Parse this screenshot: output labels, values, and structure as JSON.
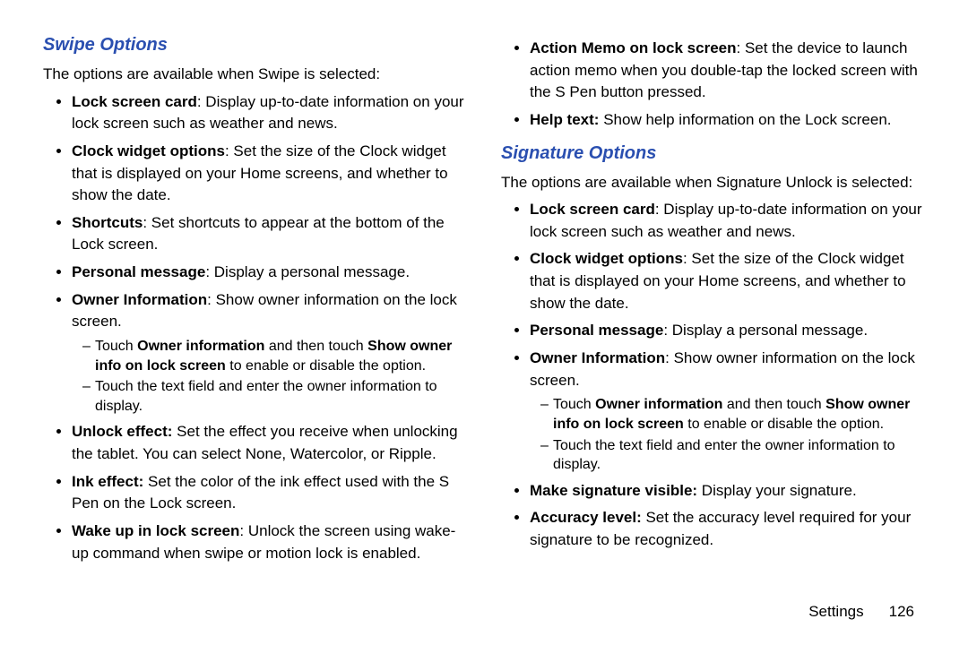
{
  "left": {
    "heading": "Swipe Options",
    "intro": "The options are available when Swipe is selected:",
    "b0": {
      "bold": "Lock screen card",
      "rest": ": Display up-to-date information on your lock screen such as weather and news."
    },
    "b1": {
      "bold": "Clock widget options",
      "rest": ": Set the size of the Clock widget that is displayed on your Home screens, and whether to show the date."
    },
    "b2": {
      "bold": "Shortcuts",
      "rest": ": Set shortcuts to appear at the bottom of the Lock screen."
    },
    "b3": {
      "bold": "Personal message",
      "rest": ": Display a personal message."
    },
    "b4": {
      "bold": "Owner Information",
      "rest": ": Show owner information on the lock screen.",
      "s0": {
        "p0": "Touch ",
        "b0": "Owner information",
        "p1": " and then touch ",
        "b1": "Show owner info on lock screen",
        "p2": " to enable or disable the option."
      },
      "s1": {
        "p0": "Touch the text field and enter the owner information to display."
      }
    },
    "b5": {
      "bold": "Unlock effect:",
      "rest": " Set the effect you receive when unlocking the tablet. You can select None, Watercolor, or Ripple."
    },
    "b6": {
      "bold": "Ink effect:",
      "rest": " Set the color of the ink effect used with the S Pen on the Lock screen."
    },
    "b7": {
      "bold": "Wake up in lock screen",
      "rest": ": Unlock the screen using wake-up command when swipe or motion lock is enabled."
    }
  },
  "right": {
    "t0": {
      "bold": "Action Memo on lock screen",
      "rest": ": Set the device to launch action memo when you double-tap the locked screen with the S Pen button pressed."
    },
    "t1": {
      "bold": "Help text:",
      "rest": " Show help information on the Lock screen."
    },
    "heading": "Signature Options",
    "intro": "The options are available when Signature Unlock is selected:",
    "b0": {
      "bold": "Lock screen card",
      "rest": ": Display up-to-date information on your lock screen such as weather and news."
    },
    "b1": {
      "bold": "Clock widget options",
      "rest": ": Set the size of the Clock widget that is displayed on your Home screens, and whether to show the date."
    },
    "b2": {
      "bold": "Personal message",
      "rest": ": Display a personal message."
    },
    "b3": {
      "bold": "Owner Information",
      "rest": ": Show owner information on the lock screen.",
      "s0": {
        "p0": "Touch ",
        "b0": "Owner information",
        "p1": " and then touch ",
        "b1": "Show owner info on lock screen",
        "p2": " to enable or disable the option."
      },
      "s1": {
        "p0": "Touch the text field and enter the owner information to display."
      }
    },
    "b4": {
      "bold": "Make signature visible:",
      "rest": " Display your signature."
    },
    "b5": {
      "bold": "Accuracy level:",
      "rest": " Set the accuracy level required for your signature to be recognized."
    }
  },
  "footer": {
    "section": "Settings",
    "page": "126"
  }
}
